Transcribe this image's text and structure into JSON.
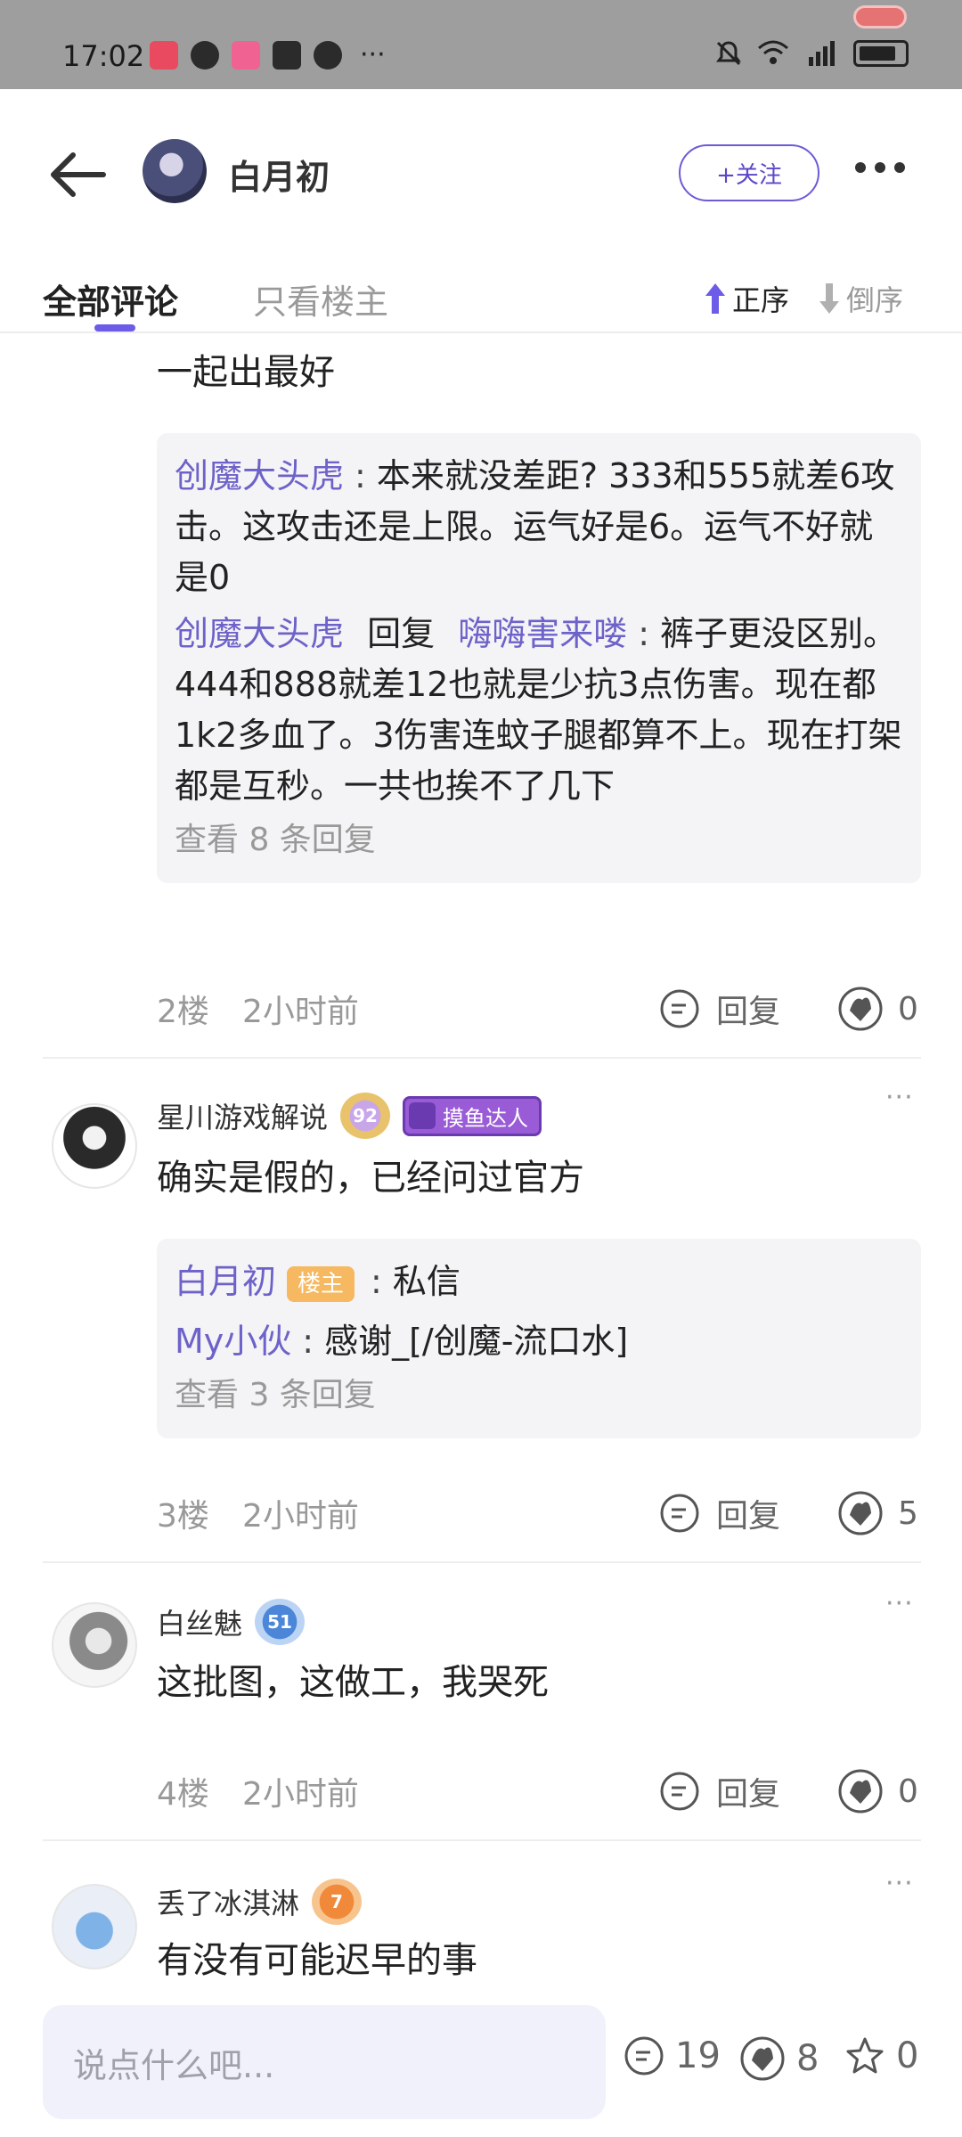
{
  "status_bar": {
    "time": "17:02",
    "more": "···"
  },
  "header": {
    "title": "白月初",
    "follow_label": "+关注"
  },
  "tabs": {
    "all": "全部评论",
    "owner_only": "只看楼主",
    "asc": "正序",
    "desc": "倒序"
  },
  "comments": [
    {
      "continued_text": "一起出最好",
      "replies": [
        {
          "name": "创魔大头虎",
          "text": "本来就没差距? 333和555就差6攻击。这攻击还是上限。运气好是6。运气不好就是0"
        },
        {
          "name": "创魔大头虎",
          "reply_word": "回复",
          "target": "嗨嗨害来喽",
          "text": "裤子更没区别。444和888就差12也就是少抗3点伤害。现在都1k2多血了。3伤害连蚊子腿都算不上。现在打架都是互秒。一共也挨不了几下"
        }
      ],
      "view_more": "查看 8 条回复",
      "floor": "2楼",
      "time": "2小时前",
      "reply_label": "回复",
      "likes": "0"
    },
    {
      "user": "星川游戏解说",
      "level": "92",
      "tag": "摸鱼达人",
      "text": "确实是假的，已经问过官方",
      "replies": [
        {
          "name": "白月初",
          "badge": "楼主",
          "text": "私信"
        },
        {
          "name": "My小伙",
          "text": "感谢_[/创魔-流口水]"
        }
      ],
      "view_more": "查看 3 条回复",
      "floor": "3楼",
      "time": "2小时前",
      "reply_label": "回复",
      "likes": "5"
    },
    {
      "user": "白丝魅",
      "level": "51",
      "text": "这批图，这做工，我哭死",
      "floor": "4楼",
      "time": "2小时前",
      "reply_label": "回复",
      "likes": "0"
    },
    {
      "user": "丢了冰淇淋",
      "level": "7",
      "text": "有没有可能迟早的事"
    }
  ],
  "bottom_bar": {
    "input_placeholder": "说点什么吧...",
    "comments": "19",
    "likes": "8",
    "stars": "0"
  },
  "colors": {
    "accent": "#6c5ce7",
    "reply_name": "#6d62c9",
    "owner_badge": "#f6b860"
  }
}
